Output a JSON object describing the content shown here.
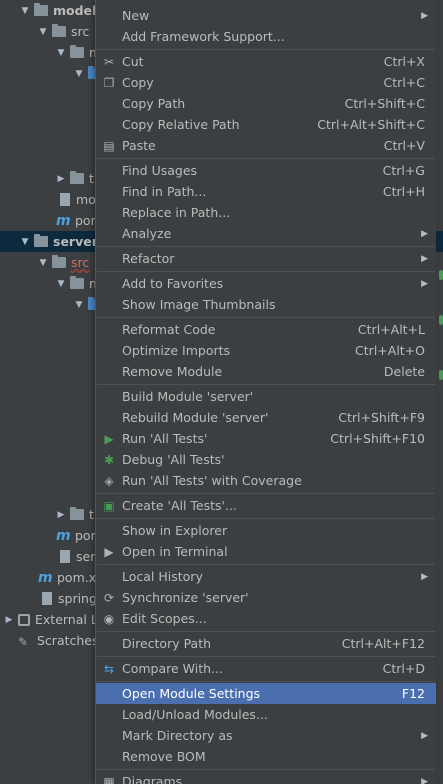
{
  "tree": {
    "items": [
      {
        "label": "model"
      },
      {
        "label": "src"
      },
      {
        "label": "m"
      },
      {
        "label": "t"
      },
      {
        "label": "moc"
      },
      {
        "label": "pom"
      },
      {
        "label": "server"
      },
      {
        "label": "src"
      },
      {
        "label": "m"
      },
      {
        "label": "t"
      },
      {
        "label": "pom"
      },
      {
        "label": "serv"
      },
      {
        "label": "pom.xm"
      },
      {
        "label": "springl"
      },
      {
        "label": "External L"
      },
      {
        "label": "Scratches"
      }
    ]
  },
  "menu": {
    "items": [
      {
        "label": "New",
        "shortcut": "",
        "submenu": true
      },
      {
        "label": "Add Framework Support...",
        "shortcut": ""
      },
      {
        "label": "Cut",
        "shortcut": "Ctrl+X",
        "icon": "scissors-icon"
      },
      {
        "label": "Copy",
        "shortcut": "Ctrl+C",
        "icon": "copy-icon"
      },
      {
        "label": "Copy Path",
        "shortcut": "Ctrl+Shift+C"
      },
      {
        "label": "Copy Relative Path",
        "shortcut": "Ctrl+Alt+Shift+C"
      },
      {
        "label": "Paste",
        "shortcut": "Ctrl+V",
        "icon": "paste-icon"
      },
      {
        "label": "Find Usages",
        "shortcut": "Ctrl+G"
      },
      {
        "label": "Find in Path...",
        "shortcut": "Ctrl+H"
      },
      {
        "label": "Replace in Path...",
        "shortcut": ""
      },
      {
        "label": "Analyze",
        "shortcut": "",
        "submenu": true
      },
      {
        "label": "Refactor",
        "shortcut": "",
        "submenu": true
      },
      {
        "label": "Add to Favorites",
        "shortcut": "",
        "submenu": true
      },
      {
        "label": "Show Image Thumbnails",
        "shortcut": ""
      },
      {
        "label": "Reformat Code",
        "shortcut": "Ctrl+Alt+L"
      },
      {
        "label": "Optimize Imports",
        "shortcut": "Ctrl+Alt+O"
      },
      {
        "label": "Remove Module",
        "shortcut": "Delete"
      },
      {
        "label": "Build Module 'server'",
        "shortcut": ""
      },
      {
        "label": "Rebuild Module 'server'",
        "shortcut": "Ctrl+Shift+F9"
      },
      {
        "label": "Run 'All Tests'",
        "shortcut": "Ctrl+Shift+F10",
        "icon": "run-icon"
      },
      {
        "label": "Debug 'All Tests'",
        "shortcut": "",
        "icon": "debug-icon"
      },
      {
        "label": "Run 'All Tests' with Coverage",
        "shortcut": "",
        "icon": "coverage-icon"
      },
      {
        "label": "Create 'All Tests'...",
        "shortcut": "",
        "icon": "create-config-icon"
      },
      {
        "label": "Show in Explorer",
        "shortcut": ""
      },
      {
        "label": "Open in Terminal",
        "shortcut": "",
        "icon": "terminal-icon"
      },
      {
        "label": "Local History",
        "shortcut": "",
        "submenu": true
      },
      {
        "label": "Synchronize 'server'",
        "shortcut": "",
        "icon": "sync-icon"
      },
      {
        "label": "Edit Scopes...",
        "shortcut": "",
        "icon": "scopes-icon"
      },
      {
        "label": "Directory Path",
        "shortcut": "Ctrl+Alt+F12"
      },
      {
        "label": "Compare With...",
        "shortcut": "Ctrl+D",
        "icon": "compare-icon"
      },
      {
        "label": "Open Module Settings",
        "shortcut": "F12"
      },
      {
        "label": "Load/Unload Modules...",
        "shortcut": ""
      },
      {
        "label": "Mark Directory as",
        "shortcut": "",
        "submenu": true
      },
      {
        "label": "Remove BOM",
        "shortcut": ""
      },
      {
        "label": "Diagrams",
        "shortcut": "",
        "submenu": true,
        "icon": "diagrams-icon"
      }
    ]
  },
  "colors": {
    "background": "#3c3f41",
    "highlight": "#4b6eaf",
    "selected_tree_row": "#0d293e",
    "run_green": "#499c54"
  }
}
